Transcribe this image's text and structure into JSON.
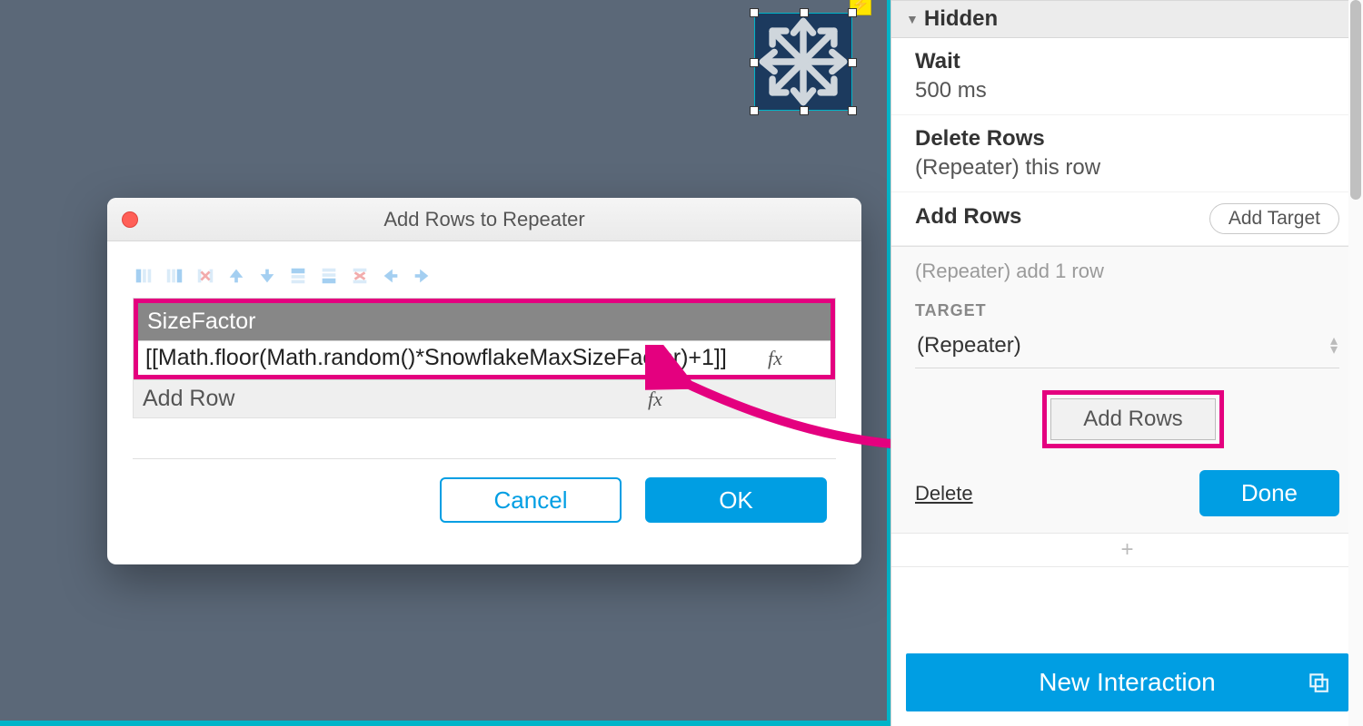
{
  "canvas": {
    "selected_object": "snowflake",
    "bolt_badge": "lightning"
  },
  "dialog": {
    "title": "Add Rows to Repeater",
    "column_header": "SizeFactor",
    "cell_value": "[[Math.floor(Math.random()*SnowflakeMaxSizeFactor)+1]]",
    "add_row_label": "Add Row",
    "fx_label": "fx",
    "cancel": "Cancel",
    "ok": "OK",
    "toolbar_icons": [
      "insert-col-left",
      "insert-col-right",
      "delete-col",
      "move-up",
      "move-down",
      "insert-row-above",
      "insert-row-below",
      "delete-row",
      "move-left",
      "move-right"
    ]
  },
  "panel": {
    "section": "Hidden",
    "cases": [
      {
        "title": "Wait",
        "sub": "500 ms"
      },
      {
        "title": "Delete Rows",
        "sub": "(Repeater) this row"
      },
      {
        "title": "Add Rows",
        "add_target": "Add Target"
      }
    ],
    "sub": {
      "summary": "(Repeater) add 1 row",
      "target_label": "TARGET",
      "target_value": "(Repeater)",
      "addrows_btn": "Add Rows",
      "delete": "Delete",
      "done": "Done"
    },
    "plus": "+",
    "new_interaction": "New Interaction"
  },
  "colors": {
    "accent": "#009ee3",
    "highlight": "#e4007f",
    "canvas_bg": "#5b6878",
    "teal_border": "#00b4c8"
  }
}
